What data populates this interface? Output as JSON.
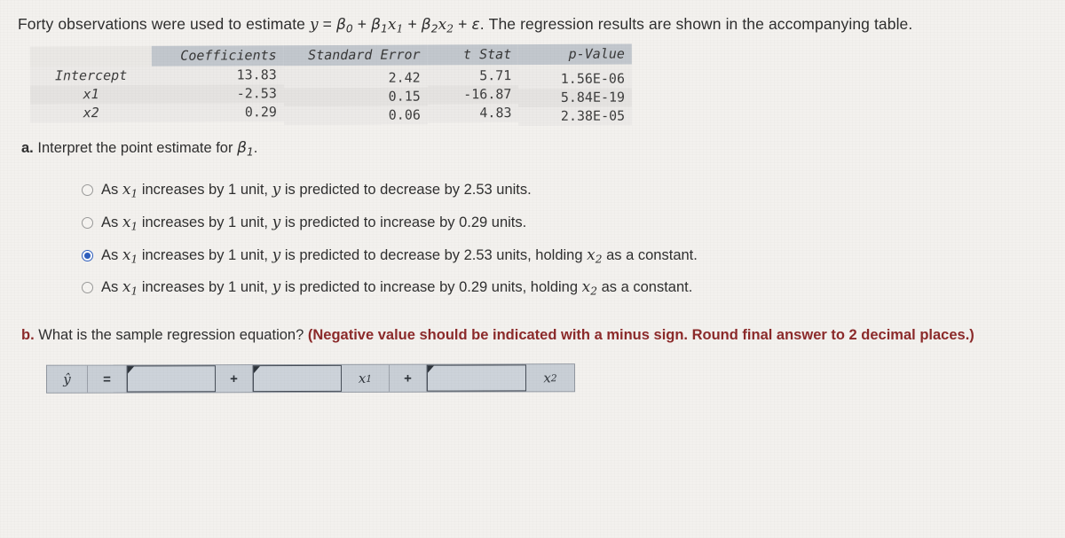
{
  "question": {
    "prompt_prefix": "Forty observations were used to estimate",
    "equation": {
      "lhs": "y",
      "equals": "=",
      "term0": "β",
      "term0_sub": "0",
      "plus1": "+",
      "term1": "β",
      "term1_sub": "1",
      "term1_var": "x",
      "term1_var_sub": "1",
      "plus2": "+",
      "term2": "β",
      "term2_sub": "2",
      "term2_var": "x",
      "term2_var_sub": "2",
      "plus3": "+",
      "error": "ε"
    },
    "prompt_suffix": ". The regression results are shown in the accompanying table."
  },
  "regression_table": {
    "corner_header": "",
    "headers": [
      "Coefficients",
      "Standard Error",
      "t Stat",
      "p-Value"
    ],
    "rows": [
      {
        "label": "Intercept",
        "coefficient": "13.83",
        "standard_error": "2.42",
        "t_stat": "5.71",
        "p_value": "1.56E-06"
      },
      {
        "label": "x1",
        "coefficient": "-2.53",
        "standard_error": "0.15",
        "t_stat": "-16.87",
        "p_value": "5.84E-19"
      },
      {
        "label": "x2",
        "coefficient": "0.29",
        "standard_error": "0.06",
        "t_stat": "4.83",
        "p_value": "2.38E-05"
      }
    ]
  },
  "part_a": {
    "label": "a.",
    "text": "Interpret the point estimate for",
    "symbol": "β",
    "symbol_sub": "1",
    "period": ".",
    "options": [
      {
        "id": "option-1",
        "selected": false,
        "prefix": "As",
        "var": "x",
        "var_sub": "1",
        "text": "increases by 1 unit,",
        "y": "y",
        "tail": "is predicted to decrease by 2.53 units.",
        "holding": "",
        "holding_var": "",
        "holding_var_sub": "",
        "holding_tail": ""
      },
      {
        "id": "option-2",
        "selected": false,
        "prefix": "As",
        "var": "x",
        "var_sub": "1",
        "text": "increases by 1 unit,",
        "y": "y",
        "tail": "is predicted to increase by 0.29 units.",
        "holding": "",
        "holding_var": "",
        "holding_var_sub": "",
        "holding_tail": ""
      },
      {
        "id": "option-3",
        "selected": true,
        "prefix": "As",
        "var": "x",
        "var_sub": "1",
        "text": "increases by 1 unit,",
        "y": "y",
        "tail": "is predicted to decrease by 2.53 units, holding",
        "holding": "",
        "holding_var": "x",
        "holding_var_sub": "2",
        "holding_tail": "as a constant."
      },
      {
        "id": "option-4",
        "selected": false,
        "prefix": "As",
        "var": "x",
        "var_sub": "1",
        "text": "increases by 1 unit,",
        "y": "y",
        "tail": "is predicted to increase by 0.29 units, holding",
        "holding": "",
        "holding_var": "x",
        "holding_var_sub": "2",
        "holding_tail": "as a constant."
      }
    ]
  },
  "part_b": {
    "label": "b.",
    "text": "What is the sample regression equation?",
    "note": "(Negative value should be indicated with a minus sign. Round final answer to 2 decimal places.)",
    "answer_row": {
      "yhat": "ŷ",
      "equals": "=",
      "input_intercept": "",
      "input_intercept_placeholder": "",
      "plus_1": "+",
      "input_b1": "",
      "input_b1_placeholder": "",
      "var_1": "x",
      "var_1_sub": "1",
      "plus_2": "+",
      "input_b2": "",
      "input_b2_placeholder": "",
      "var_2": "x",
      "var_2_sub": "2"
    }
  },
  "colors": {
    "page_background": "#f3f1ee",
    "body_text": "#2f2f2f",
    "note_red": "#8c2a2a",
    "radio_selected": "#2f5fbe",
    "table_header": "#c3c8ce",
    "input_fill": "#cdd3db",
    "input_border": "#454c56"
  }
}
